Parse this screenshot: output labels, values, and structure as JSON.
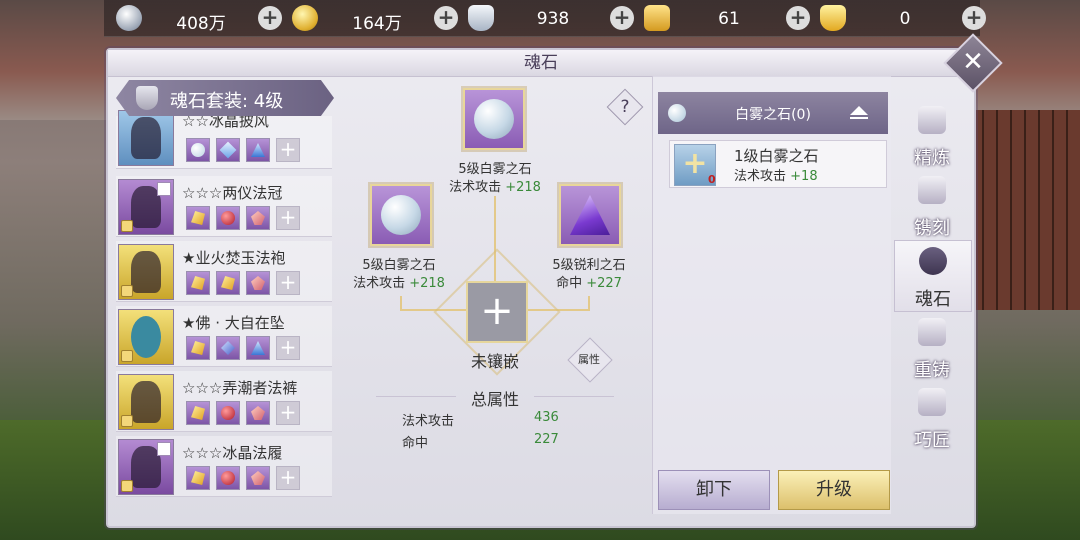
{
  "currencies": [
    {
      "icon": "silver-coin-icon",
      "value": "408万"
    },
    {
      "icon": "gold-coin-icon",
      "value": "164万"
    },
    {
      "icon": "silver-ingot-icon",
      "value": "938"
    },
    {
      "icon": "locked-gold-icon",
      "value": "61"
    },
    {
      "icon": "gold-ingot-icon",
      "value": "0"
    }
  ],
  "plus_symbol": "+",
  "panel": {
    "title": "魂石",
    "close": "✕",
    "help": "?"
  },
  "set": {
    "label": "魂石套装: 4级"
  },
  "equipment": [
    {
      "name": "☆☆冰晶披风",
      "frame": "blue",
      "gems": [
        "pearl",
        "crystal",
        "tri",
        "empty"
      ]
    },
    {
      "name": "☆☆☆两仪法冠",
      "frame": "purple",
      "gems": [
        "amber",
        "ruby",
        "pink",
        "empty"
      ]
    },
    {
      "name": "★业火焚玉法袍",
      "frame": "yellow",
      "gems": [
        "amber",
        "amber",
        "pink",
        "empty"
      ]
    },
    {
      "name": "★佛 · 大自在坠",
      "frame": "yellow",
      "gems": [
        "amber",
        "sapph",
        "tri",
        "empty"
      ]
    },
    {
      "name": "☆☆☆弄潮者法裤",
      "frame": "yellow",
      "gems": [
        "amber",
        "ruby",
        "pink",
        "empty"
      ]
    },
    {
      "name": "☆☆☆冰晶法履",
      "frame": "purple",
      "gems": [
        "amber",
        "ruby",
        "pink",
        "empty"
      ]
    }
  ],
  "sockets": {
    "top": {
      "name": "5级白雾之石",
      "attr": "法术攻击",
      "value": "+218"
    },
    "left": {
      "name": "5级白雾之石",
      "attr": "法术攻击",
      "value": "+218"
    },
    "right": {
      "name": "5级锐利之石",
      "attr": "命中",
      "value": "+227"
    },
    "center": {
      "label": "未镶嵌",
      "plus": "+"
    }
  },
  "attr_button": "属性",
  "totals": {
    "title": "总属性",
    "rows": [
      {
        "name": "法术攻击",
        "value": "436"
      },
      {
        "name": "命中",
        "value": "227"
      }
    ]
  },
  "stone_list": {
    "header": "白雾之石(0)",
    "items": [
      {
        "name": "1级白雾之石",
        "attr": "法术攻击",
        "value": "+18",
        "count": "0"
      }
    ]
  },
  "buttons": {
    "unload": "卸下",
    "upgrade": "升级"
  },
  "tabs": [
    {
      "label": "精炼",
      "active": false
    },
    {
      "label": "镌刻",
      "active": false
    },
    {
      "label": "魂石",
      "active": true
    },
    {
      "label": "重铸",
      "active": false
    },
    {
      "label": "巧匠",
      "active": false
    }
  ],
  "colors": {
    "accent": "#6e6588",
    "positive": "#3a8a3a",
    "highlight": "#e8d69a"
  }
}
